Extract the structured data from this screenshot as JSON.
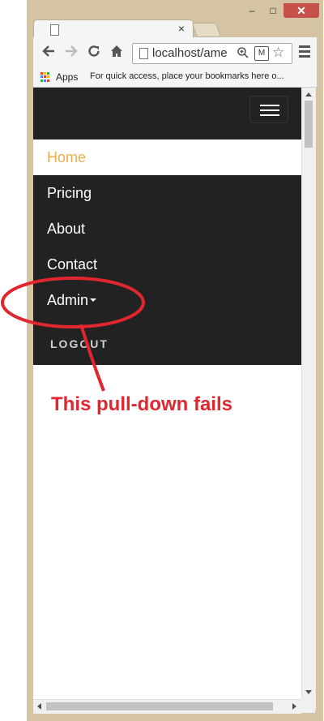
{
  "browser": {
    "tab_close": "×",
    "address_text": "localhost/ame",
    "extension_label": "M",
    "bookmarks_apps_label": "Apps",
    "bookmarks_hint": "For quick access, place your bookmarks here o..."
  },
  "window_controls": {
    "minimize": "–",
    "maximize": "□",
    "close": "✕"
  },
  "nav": {
    "items": [
      {
        "label": "Home",
        "active": true
      },
      {
        "label": "Pricing"
      },
      {
        "label": "About"
      },
      {
        "label": "Contact"
      },
      {
        "label": "Admin",
        "dropdown": true
      }
    ],
    "logout": "LOGOUT"
  },
  "annotation": {
    "text": "This pull-down fails"
  },
  "colors": {
    "navbar_bg": "#222222",
    "active_link": "#f0ad4e",
    "annotation_red": "#e0262f"
  },
  "icons": {
    "back": "back-arrow-icon",
    "forward": "forward-arrow-icon",
    "reload": "reload-icon",
    "home": "home-icon",
    "zoom": "zoom-icon",
    "star": "star-icon",
    "menu": "hamburger-menu-icon"
  }
}
